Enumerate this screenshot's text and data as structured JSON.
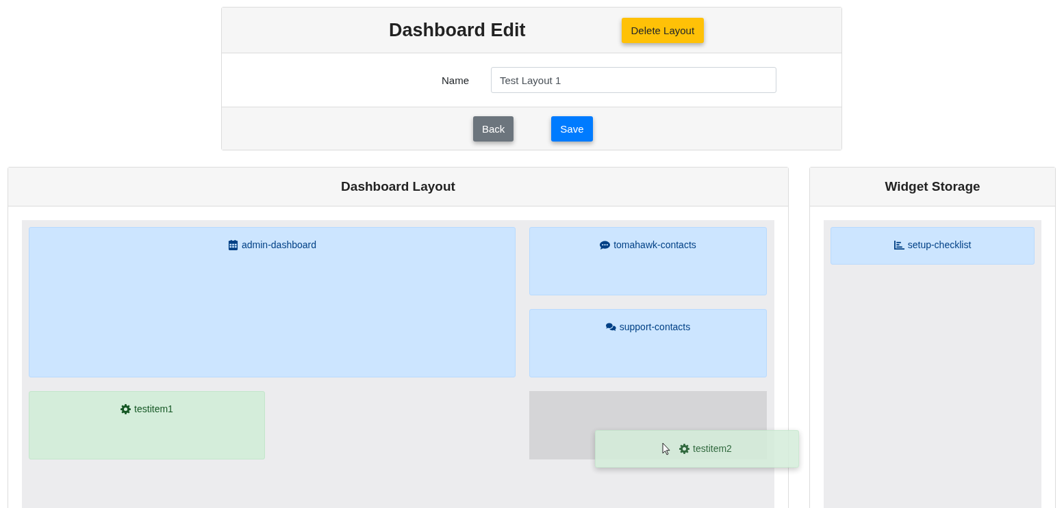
{
  "editor": {
    "title": "Dashboard Edit",
    "delete_button": "Delete Layout",
    "name_label": "Name",
    "name_value": "Test Layout 1",
    "back_button": "Back",
    "save_button": "Save"
  },
  "layout_panel": {
    "title": "Dashboard Layout",
    "widgets": [
      {
        "label": "admin-dashboard",
        "kind": "info"
      },
      {
        "label": "tomahawk-contacts",
        "kind": "info"
      },
      {
        "label": "support-contacts",
        "kind": "info"
      },
      {
        "label": "testitem1",
        "kind": "success"
      }
    ],
    "dragged_widget": {
      "label": "testitem2",
      "kind": "success"
    }
  },
  "storage_panel": {
    "title": "Widget Storage",
    "widgets": [
      {
        "label": "setup-checklist",
        "kind": "info"
      }
    ]
  }
}
